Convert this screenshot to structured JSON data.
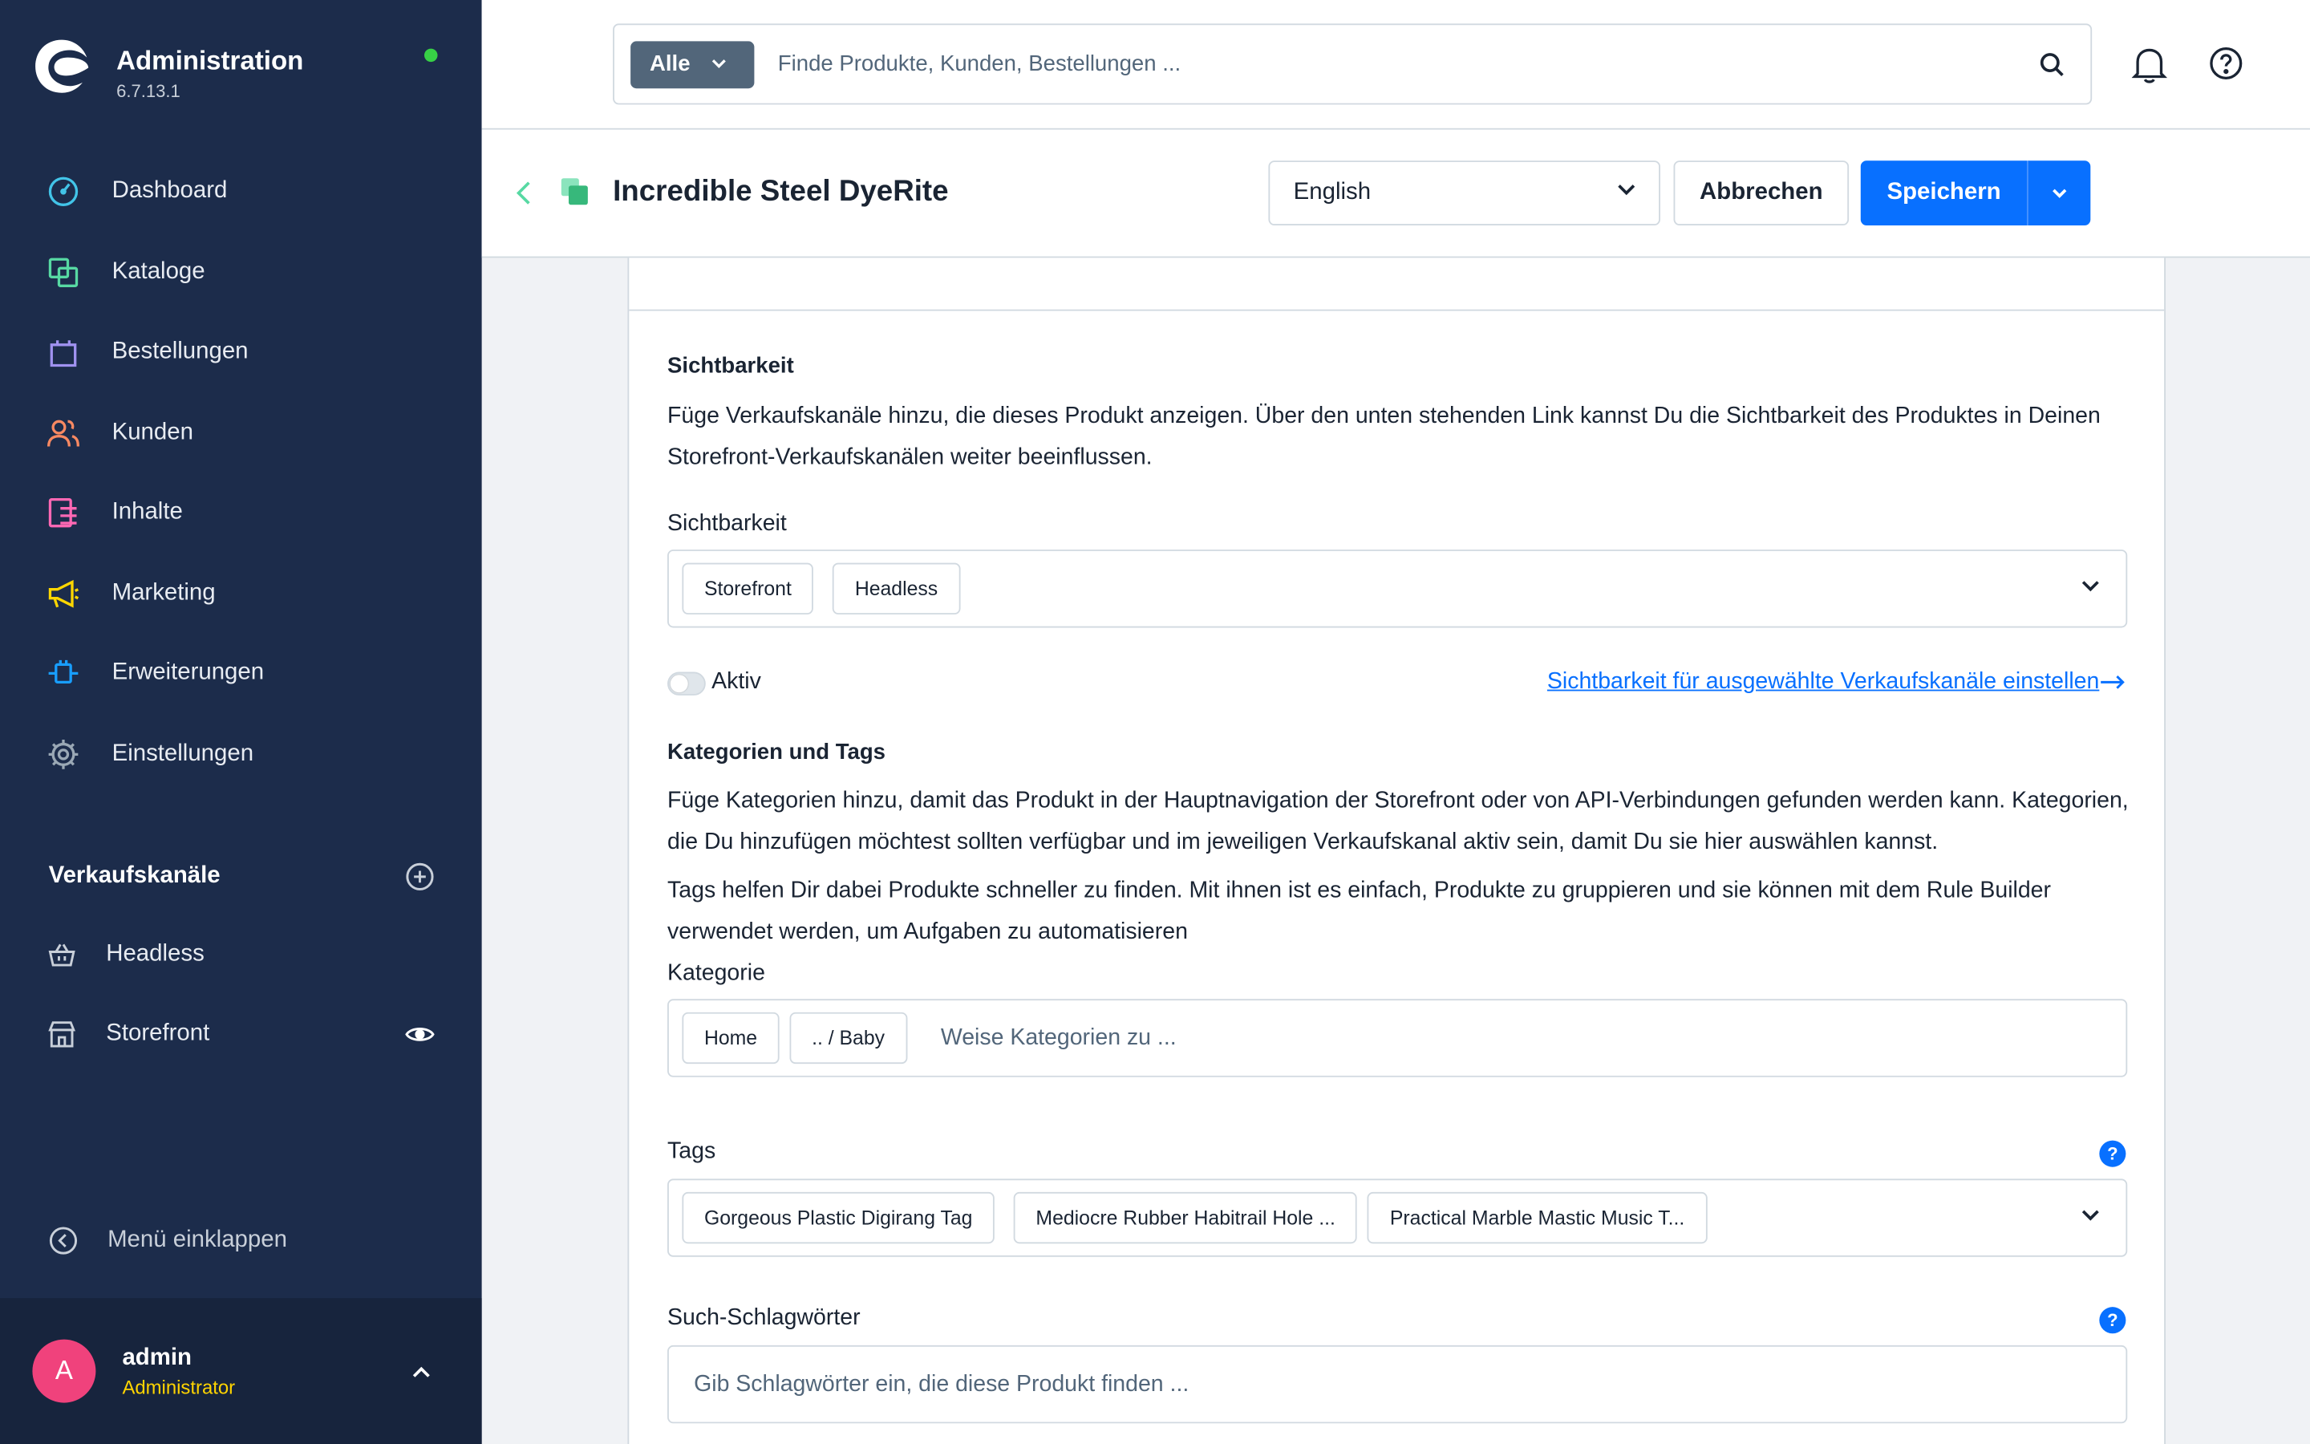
{
  "sidebar": {
    "brand_title": "Administration",
    "version": "6.7.13.1",
    "nav": [
      {
        "label": "Dashboard",
        "icon": "gauge-icon",
        "color": "#42c4e8"
      },
      {
        "label": "Kataloge",
        "icon": "catalog-icon",
        "color": "#57d9a3"
      },
      {
        "label": "Bestellungen",
        "icon": "shopping-bag-icon",
        "color": "#a092f0"
      },
      {
        "label": "Kunden",
        "icon": "users-icon",
        "color": "#f88962"
      },
      {
        "label": "Inhalte",
        "icon": "content-icon",
        "color": "#ff68b4"
      },
      {
        "label": "Marketing",
        "icon": "megaphone-icon",
        "color": "#ffd700"
      },
      {
        "label": "Erweiterungen",
        "icon": "plug-icon",
        "color": "#189eff"
      },
      {
        "label": "Einstellungen",
        "icon": "gear-icon",
        "color": "#9aa8b5"
      }
    ],
    "sales_channels_title": "Verkaufskanäle",
    "sales_channels": [
      {
        "label": "Headless",
        "icon": "basket-icon"
      },
      {
        "label": "Storefront",
        "icon": "storefront-icon"
      }
    ],
    "collapse_label": "Menü einklappen",
    "user": {
      "initial": "A",
      "name": "admin",
      "role": "Administrator"
    }
  },
  "topbar": {
    "search_type": "Alle",
    "search_placeholder": "Finde Produkte, Kunden, Bestellungen ..."
  },
  "smartbar": {
    "title": "Incredible Steel DyeRite",
    "language": "English",
    "cancel_label": "Abbrechen",
    "save_label": "Speichern"
  },
  "visibility": {
    "heading": "Sichtbarkeit",
    "description": "Füge Verkaufskanäle hinzu, die dieses Produkt anzeigen. Über den unten stehenden Link kannst Du die Sichtbarkeit des Produktes in Deinen Storefront-Verkaufskanälen weiter beeinflussen.",
    "field_label": "Sichtbarkeit",
    "chips": [
      "Storefront",
      "Headless"
    ],
    "active_label": "Aktiv",
    "link_label": "Sichtbarkeit für ausgewählte Verkaufskanäle einstellen"
  },
  "categories": {
    "heading": "Kategorien und Tags",
    "description": "Füge Kategorien hinzu, damit das Produkt in der Hauptnavigation der Storefront oder von API-Verbindungen gefunden werden kann. Kategorien, die Du hinzufügen möchtest sollten verfügbar und im jeweiligen Verkaufskanal aktiv sein, damit Du sie hier auswählen kannst.",
    "tags_description": "Tags helfen Dir dabei Produkte schneller zu finden. Mit ihnen ist es einfach, Produkte zu gruppieren und sie können mit dem Rule Builder verwendet werden, um Aufgaben zu automatisieren",
    "category_label": "Kategorie",
    "category_chips": [
      "Home",
      ".. / Baby"
    ],
    "category_placeholder": "Weise Kategorien zu ...",
    "tags_label": "Tags",
    "tag_chips": [
      "Gorgeous Plastic Digirang Tag",
      "Mediocre Rubber Habitrail Hole ...",
      "Practical Marble Mastic Music T..."
    ],
    "keywords_label": "Such-Schlagwörter",
    "keywords_placeholder": "Gib Schlagwörter ein, die diese Produkt finden ..."
  }
}
